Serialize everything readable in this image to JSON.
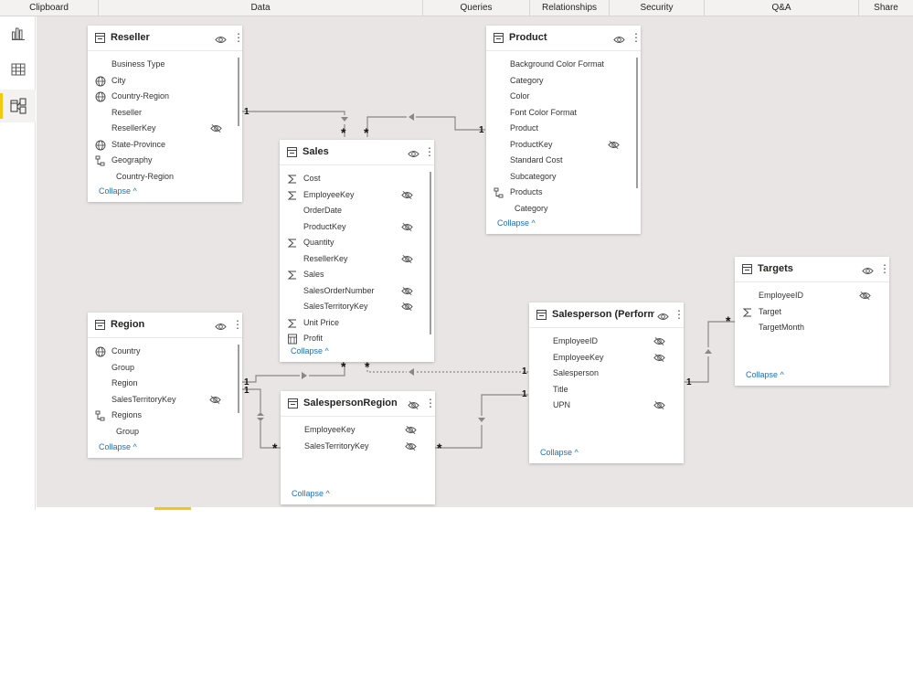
{
  "ribbon": {
    "groups": [
      "Clipboard",
      "Data",
      "Queries",
      "Relationships",
      "Security",
      "Q&A",
      "Share"
    ]
  },
  "nav": {
    "items": [
      "report-view-icon",
      "data-view-icon",
      "model-view-icon"
    ],
    "active": "model-view-icon"
  },
  "colors": {
    "accent": "#f2c811",
    "link": "#1f6fc1",
    "canvas": "#e8e5e4"
  },
  "collapse_label": "Collapse ^",
  "tables": {
    "reseller": {
      "title": "Reseller",
      "fields": [
        {
          "label": "Business Type",
          "icon": "none",
          "hidden": false
        },
        {
          "label": "City",
          "icon": "globe-icon",
          "hidden": false
        },
        {
          "label": "Country-Region",
          "icon": "globe-icon",
          "hidden": false
        },
        {
          "label": "Reseller",
          "icon": "none",
          "hidden": false
        },
        {
          "label": "ResellerKey",
          "icon": "none",
          "hidden": true
        },
        {
          "label": "State-Province",
          "icon": "globe-icon",
          "hidden": false
        },
        {
          "label": "Geography",
          "icon": "hierarchy-icon",
          "hidden": false
        },
        {
          "label": "Country-Region",
          "icon": "none",
          "hidden": false,
          "child": true
        }
      ]
    },
    "product": {
      "title": "Product",
      "fields": [
        {
          "label": "Background Color Format",
          "icon": "none",
          "hidden": false
        },
        {
          "label": "Category",
          "icon": "none",
          "hidden": false
        },
        {
          "label": "Color",
          "icon": "none",
          "hidden": false
        },
        {
          "label": "Font Color Format",
          "icon": "none",
          "hidden": false
        },
        {
          "label": "Product",
          "icon": "none",
          "hidden": false
        },
        {
          "label": "ProductKey",
          "icon": "none",
          "hidden": true
        },
        {
          "label": "Standard Cost",
          "icon": "none",
          "hidden": false
        },
        {
          "label": "Subcategory",
          "icon": "none",
          "hidden": false
        },
        {
          "label": "Products",
          "icon": "hierarchy-icon",
          "hidden": false
        },
        {
          "label": "Category",
          "icon": "none",
          "hidden": false,
          "child": true
        }
      ]
    },
    "sales": {
      "title": "Sales",
      "fields": [
        {
          "label": "Cost",
          "icon": "sigma-icon",
          "hidden": false
        },
        {
          "label": "EmployeeKey",
          "icon": "sigma-icon",
          "hidden": true
        },
        {
          "label": "OrderDate",
          "icon": "none",
          "hidden": false
        },
        {
          "label": "ProductKey",
          "icon": "none",
          "hidden": true
        },
        {
          "label": "Quantity",
          "icon": "sigma-icon",
          "hidden": false
        },
        {
          "label": "ResellerKey",
          "icon": "none",
          "hidden": true
        },
        {
          "label": "Sales",
          "icon": "sigma-icon",
          "hidden": false
        },
        {
          "label": "SalesOrderNumber",
          "icon": "none",
          "hidden": true
        },
        {
          "label": "SalesTerritoryKey",
          "icon": "none",
          "hidden": true
        },
        {
          "label": "Unit Price",
          "icon": "sigma-icon",
          "hidden": false
        },
        {
          "label": "Profit",
          "icon": "calc-icon",
          "hidden": false
        }
      ]
    },
    "region": {
      "title": "Region",
      "fields": [
        {
          "label": "Country",
          "icon": "globe-icon",
          "hidden": false
        },
        {
          "label": "Group",
          "icon": "none",
          "hidden": false
        },
        {
          "label": "Region",
          "icon": "none",
          "hidden": false
        },
        {
          "label": "SalesTerritoryKey",
          "icon": "none",
          "hidden": true
        },
        {
          "label": "Regions",
          "icon": "hierarchy-icon",
          "hidden": false
        },
        {
          "label": "Group",
          "icon": "none",
          "hidden": false,
          "child": true
        }
      ]
    },
    "salesperson_region": {
      "title": "SalespersonRegion",
      "fields": [
        {
          "label": "EmployeeKey",
          "icon": "none",
          "hidden": true
        },
        {
          "label": "SalesTerritoryKey",
          "icon": "none",
          "hidden": true
        }
      ]
    },
    "salesperson": {
      "title": "Salesperson (Perform...",
      "fields": [
        {
          "label": "EmployeeID",
          "icon": "none",
          "hidden": true
        },
        {
          "label": "EmployeeKey",
          "icon": "none",
          "hidden": true
        },
        {
          "label": "Salesperson",
          "icon": "none",
          "hidden": false
        },
        {
          "label": "Title",
          "icon": "none",
          "hidden": false
        },
        {
          "label": "UPN",
          "icon": "none",
          "hidden": true
        }
      ]
    },
    "targets": {
      "title": "Targets",
      "fields": [
        {
          "label": "EmployeeID",
          "icon": "none",
          "hidden": true
        },
        {
          "label": "Target",
          "icon": "sigma-icon",
          "hidden": false
        },
        {
          "label": "TargetMonth",
          "icon": "none",
          "hidden": false
        }
      ]
    }
  },
  "relationships": {
    "one": "1",
    "many": "*"
  }
}
